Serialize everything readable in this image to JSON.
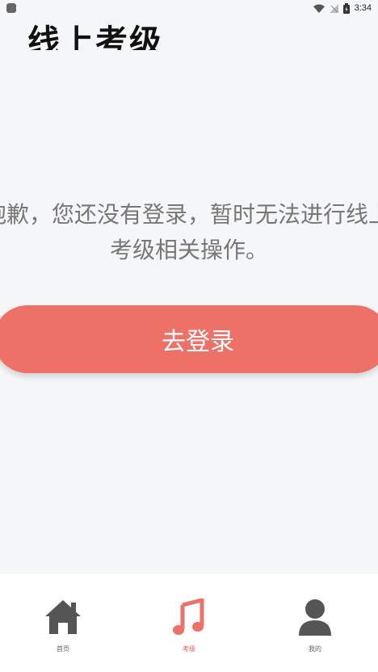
{
  "statusbar": {
    "time": "3:34"
  },
  "header": {
    "title": "线上考级"
  },
  "message": {
    "line1": "抱歉，您还没有登录，暂时无法进行线上",
    "line2": "考级相关操作。"
  },
  "login_button": {
    "label": "去登录"
  },
  "tabs": [
    {
      "label": "首页",
      "icon": "home-icon",
      "active": false
    },
    {
      "label": "考级",
      "icon": "music-note-icon",
      "active": true
    },
    {
      "label": "我的",
      "icon": "user-icon",
      "active": false
    }
  ],
  "colors": {
    "accent": "#ee7168",
    "background": "#f5f6f8",
    "icon": "#555555"
  }
}
